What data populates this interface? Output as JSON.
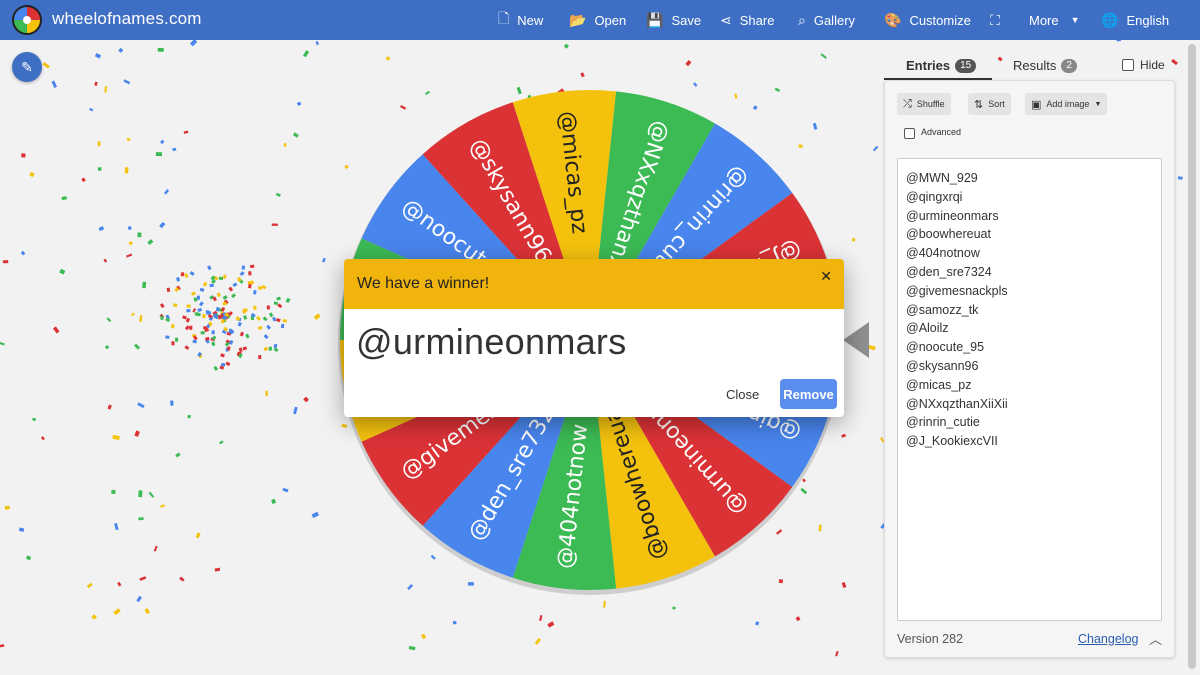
{
  "header": {
    "brand": "wheelofnames.com",
    "nav": [
      {
        "label": "New",
        "icon": "file-icon",
        "glyph": "🗋"
      },
      {
        "label": "Open",
        "icon": "folder-icon",
        "glyph": "📂"
      },
      {
        "label": "Save",
        "icon": "save-icon",
        "glyph": "💾"
      },
      {
        "label": "Share",
        "icon": "share-icon",
        "glyph": "⋖"
      },
      {
        "label": "Gallery",
        "icon": "search-icon",
        "glyph": "⌕"
      },
      {
        "label": "Customize",
        "icon": "palette-icon",
        "glyph": "🎨"
      },
      {
        "label": "",
        "icon": "fullscreen-icon",
        "glyph": "⛶"
      },
      {
        "label": "More",
        "icon": "",
        "glyph": ""
      },
      {
        "label": "English",
        "icon": "globe-icon",
        "glyph": "🌐"
      }
    ]
  },
  "wheel": {
    "colors": [
      "#3cba54",
      "#4885ed",
      "#db3236",
      "#f4c20d"
    ],
    "segments": [
      "@MWN_929",
      "@qingxrqi",
      "@urmineonmars",
      "@boowhereuat",
      "@404notnow",
      "@den_sre7324",
      "@givemesnackpls",
      "@samozz_tk",
      "@Aloilz",
      "@noocute_95",
      "@skysann96",
      "@micas_pz",
      "@NXxqzthanXiiXii",
      "@rinrin_cutie",
      "@J_KookiexcVII"
    ]
  },
  "modal": {
    "title": "We have a winner!",
    "close_glyph": "✕",
    "winner": "@urmineonmars",
    "close_label": "Close",
    "remove_label": "Remove"
  },
  "panel": {
    "tabs": [
      {
        "label": "Entries",
        "count": "15"
      },
      {
        "label": "Results",
        "count": "2"
      }
    ],
    "hide_label": "Hide",
    "tools": {
      "shuffle": "Shuffle",
      "sort": "Sort",
      "add_image": "Add image"
    },
    "advanced_label": "Advanced",
    "entries": [
      "@MWN_929",
      "@qingxrqi",
      "@urmineonmars",
      "@boowhereuat",
      "@404notnow",
      "@den_sre7324",
      "@givemesnackpls",
      "@samozz_tk",
      "@Aloilz",
      "@noocute_95",
      "@skysann96",
      "@micas_pz",
      "@NXxqzthanXiiXii",
      "@rinrin_cutie",
      "@J_KookiexcVII"
    ],
    "version": "Version 282",
    "changelog": "Changelog"
  },
  "confetti_colors": [
    "#db3236",
    "#f4c20d",
    "#3cba54",
    "#4885ed"
  ]
}
